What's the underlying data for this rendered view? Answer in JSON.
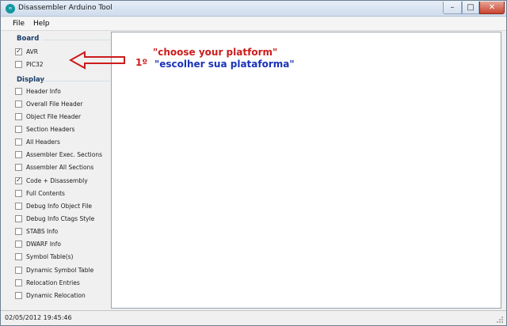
{
  "window": {
    "title": "Disassembler Arduino Tool",
    "icon_text": "∞"
  },
  "menu": [
    {
      "label": "File",
      "id": "file"
    },
    {
      "label": "Help",
      "id": "help"
    }
  ],
  "groups": {
    "board": {
      "label": "Board"
    },
    "display": {
      "label": "Display"
    }
  },
  "board_options": [
    {
      "label": "AVR",
      "checked": true
    },
    {
      "label": "PIC32",
      "checked": false
    }
  ],
  "display_options": [
    {
      "label": "Header Info",
      "checked": false
    },
    {
      "label": "Overall File Header",
      "checked": false
    },
    {
      "label": "Object File Header",
      "checked": false
    },
    {
      "label": "Section Headers",
      "checked": false
    },
    {
      "label": "All Headers",
      "checked": false
    },
    {
      "label": "Assembler Exec. Sections",
      "checked": false
    },
    {
      "label": "Assembler All Sections",
      "checked": false
    },
    {
      "label": "Code + Disassembly",
      "checked": true
    },
    {
      "label": "Full Contents",
      "checked": false
    },
    {
      "label": "Debug Info Object File",
      "checked": false
    },
    {
      "label": "Debug Info Ctags Style",
      "checked": false
    },
    {
      "label": "STABS Info",
      "checked": false
    },
    {
      "label": "DWARF Info",
      "checked": false
    },
    {
      "label": "Symbol Table(s)",
      "checked": false
    },
    {
      "label": "Dynamic Symbol Table",
      "checked": false
    },
    {
      "label": "Relocation Entries",
      "checked": false
    },
    {
      "label": "Dynamic Relocation",
      "checked": false
    }
  ],
  "annotation": {
    "step": "1º",
    "english": "\"choose your platform\"",
    "portuguese": "\"escolher sua plataforma\"",
    "colors": {
      "english": "#cc1c1c",
      "portuguese": "#1a33b8",
      "arrow": "#cc1c1c"
    }
  },
  "status": {
    "datetime": "02/05/2012 19:45:46"
  }
}
